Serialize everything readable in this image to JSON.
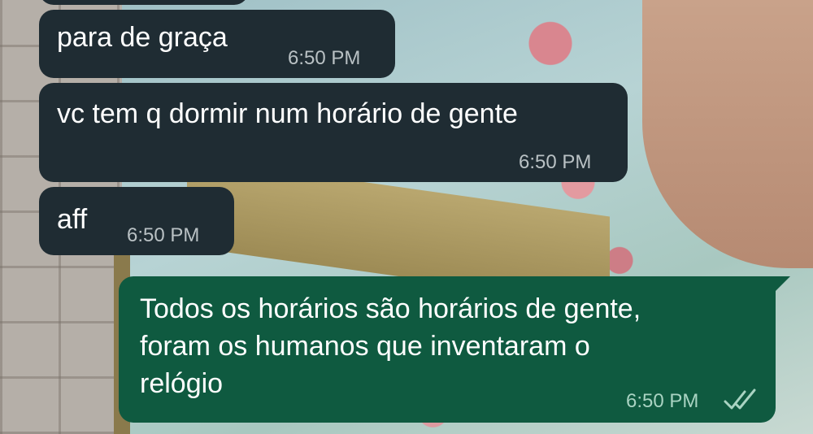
{
  "messages": [
    {
      "direction": "incoming",
      "text": "para de graça",
      "time": "6:50 PM"
    },
    {
      "direction": "incoming",
      "text": "vc tem q dormir num horário de gente",
      "time": "6:50 PM"
    },
    {
      "direction": "incoming",
      "text": "aff",
      "time": "6:50 PM"
    },
    {
      "direction": "outgoing",
      "text_lines": [
        "Todos os horários são horários de gente,",
        "foram os humanos que inventaram o",
        "relógio"
      ],
      "time": "6:50 PM",
      "status": "read-double-check-icon"
    }
  ],
  "colors": {
    "incoming_bubble": "#1f2c33",
    "outgoing_bubble": "#0f5a40",
    "text": "#ffffff",
    "incoming_time": "#b9c1c4",
    "outgoing_time": "#a9d3c2",
    "read_ticks": "#a9d3c2"
  }
}
